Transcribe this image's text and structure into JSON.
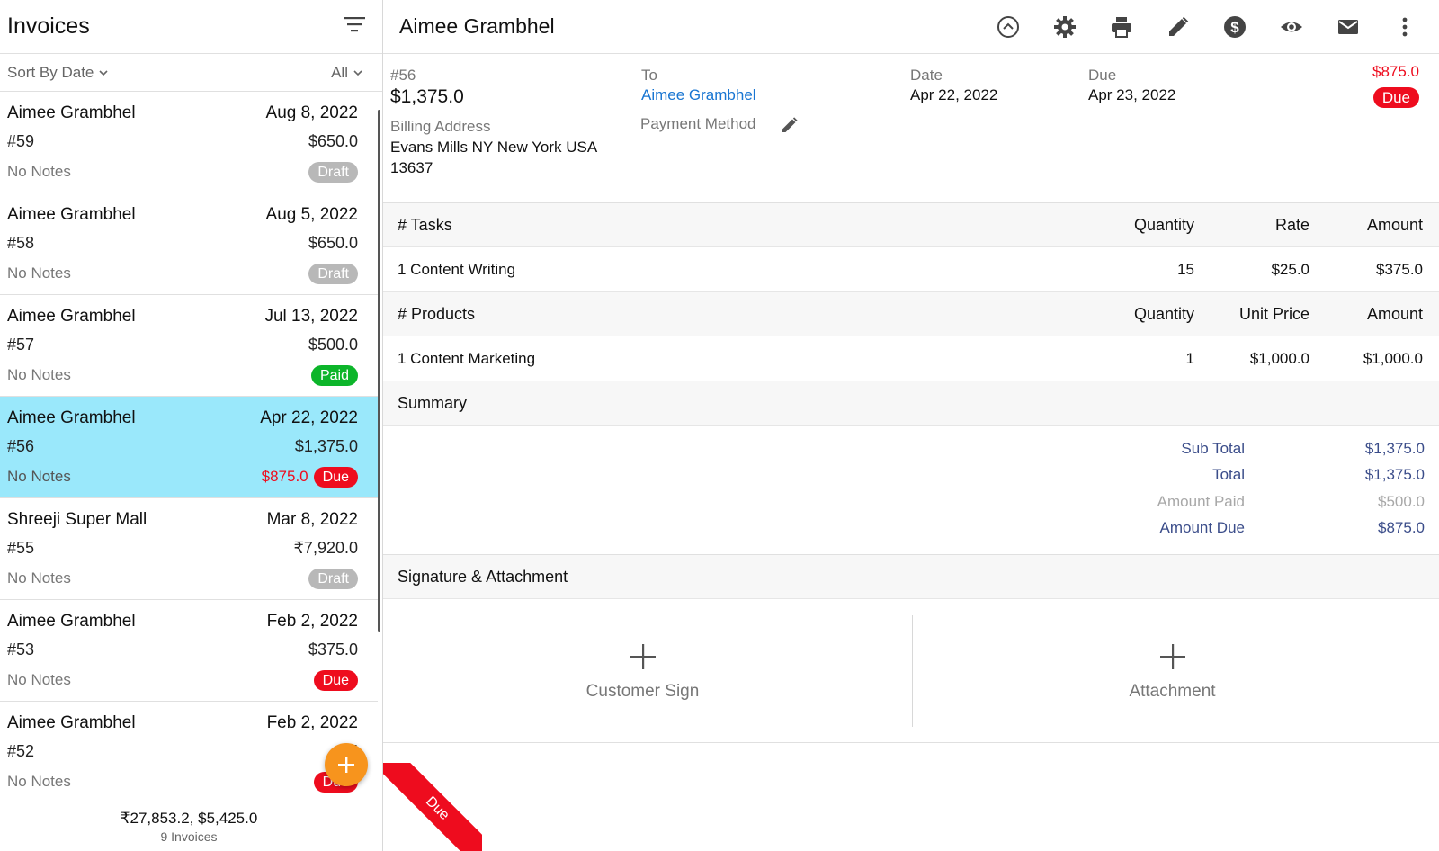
{
  "sidebar": {
    "title": "Invoices",
    "sort_label": "Sort By Date",
    "filter_label": "All",
    "invoices": [
      {
        "client": "Aimee Grambhel",
        "date": "Aug 8, 2022",
        "number": "#59",
        "amount": "$650.0",
        "notes": "No Notes",
        "status": "Draft",
        "due_amount": ""
      },
      {
        "client": "Aimee Grambhel",
        "date": "Aug 5, 2022",
        "number": "#58",
        "amount": "$650.0",
        "notes": "No Notes",
        "status": "Draft",
        "due_amount": ""
      },
      {
        "client": "Aimee Grambhel",
        "date": "Jul 13, 2022",
        "number": "#57",
        "amount": "$500.0",
        "notes": "No Notes",
        "status": "Paid",
        "due_amount": ""
      },
      {
        "client": "Aimee Grambhel",
        "date": "Apr 22, 2022",
        "number": "#56",
        "amount": "$1,375.0",
        "notes": "No Notes",
        "status": "Due",
        "due_amount": "$875.0"
      },
      {
        "client": "Shreeji Super Mall",
        "date": "Mar 8, 2022",
        "number": "#55",
        "amount": "₹7,920.0",
        "notes": "No Notes",
        "status": "Draft",
        "due_amount": ""
      },
      {
        "client": "Aimee Grambhel",
        "date": "Feb 2, 2022",
        "number": "#53",
        "amount": "$375.0",
        "notes": "No Notes",
        "status": "Due",
        "due_amount": ""
      },
      {
        "client": "Aimee Grambhel",
        "date": "Feb 2, 2022",
        "number": "#52",
        "amount": "$5",
        "notes": "No Notes",
        "status": "Due",
        "due_amount": ""
      }
    ],
    "selected_index": 3,
    "footer_totals": "₹27,853.2, $5,425.0",
    "footer_count": "9 Invoices"
  },
  "detail": {
    "title": "Aimee Grambhel",
    "toolbar_icons": [
      "collapse-up-icon",
      "gear-icon",
      "print-icon",
      "pencil-icon",
      "dollar-icon",
      "eye-icon",
      "mail-icon",
      "more-vert-icon"
    ],
    "invoice_number": "#56",
    "invoice_total": "$1,375.0",
    "billing_address_label": "Billing Address",
    "billing_address_line1": "Evans Mills NY New York USA",
    "billing_address_line2": "13637",
    "to_label": "To",
    "to_value": "Aimee Grambhel",
    "payment_method_label": "Payment Method",
    "date_label": "Date",
    "date_value": "Apr 22, 2022",
    "due_label": "Due",
    "due_value": "Apr 23, 2022",
    "due_amount": "$875.0",
    "status": "Due",
    "tasks_header": {
      "name": "# Tasks",
      "qty": "Quantity",
      "rate": "Rate",
      "amount": "Amount"
    },
    "tasks": [
      {
        "name": "1 Content Writing",
        "qty": "15",
        "rate": "$25.0",
        "amount": "$375.0"
      }
    ],
    "products_header": {
      "name": "# Products",
      "qty": "Quantity",
      "rate": "Unit Price",
      "amount": "Amount"
    },
    "products": [
      {
        "name": "1 Content Marketing",
        "qty": "1",
        "rate": "$1,000.0",
        "amount": "$1,000.0"
      }
    ],
    "summary_title": "Summary",
    "summary": {
      "subtotal_label": "Sub Total",
      "subtotal": "$1,375.0",
      "total_label": "Total",
      "total": "$1,375.0",
      "paid_label": "Amount Paid",
      "paid": "$500.0",
      "due_label": "Amount Due",
      "due": "$875.0"
    },
    "signature_title": "Signature & Attachment",
    "customer_sign_label": "Customer Sign",
    "attachment_label": "Attachment",
    "ribbon_label": "Due"
  },
  "colors": {
    "selected_row": "#9ae8fb",
    "due_red": "#ee0c1e",
    "paid_green": "#0cb52a",
    "draft_grey": "#b8b8b8",
    "fab_orange": "#f7941d",
    "link_blue": "#1976d2",
    "summary_navy": "#3b4d8a"
  }
}
